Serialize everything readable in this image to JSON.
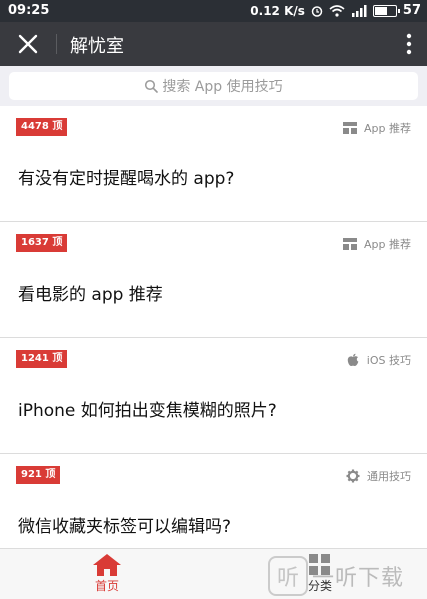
{
  "status": {
    "time": "09:25",
    "net_speed": "0.12 K/s",
    "battery": "57"
  },
  "nav": {
    "title": "解忧室"
  },
  "search": {
    "placeholder": "搜索 App 使用技巧"
  },
  "cards": [
    {
      "votes": "4478 顶",
      "category": "App 推荐",
      "category_icon": "grid-icon",
      "title": "有没有定时提醒喝水的 app?"
    },
    {
      "votes": "1637 顶",
      "category": "App 推荐",
      "category_icon": "grid-icon",
      "title": "看电影的 app 推荐"
    },
    {
      "votes": "1241 顶",
      "category": "iOS 技巧",
      "category_icon": "apple-icon",
      "title": "iPhone 如何拍出变焦模糊的照片?"
    },
    {
      "votes": "921 顶",
      "category": "通用技巧",
      "category_icon": "gear-icon",
      "title": "微信收藏夹标签可以编辑吗?"
    }
  ],
  "tabs": {
    "home": "首页",
    "category": "分类"
  },
  "watermark": {
    "text": "一听下载"
  },
  "colors": {
    "accent": "#d93b36",
    "navbar": "#393a3f",
    "statusbar": "#2b2f35"
  }
}
